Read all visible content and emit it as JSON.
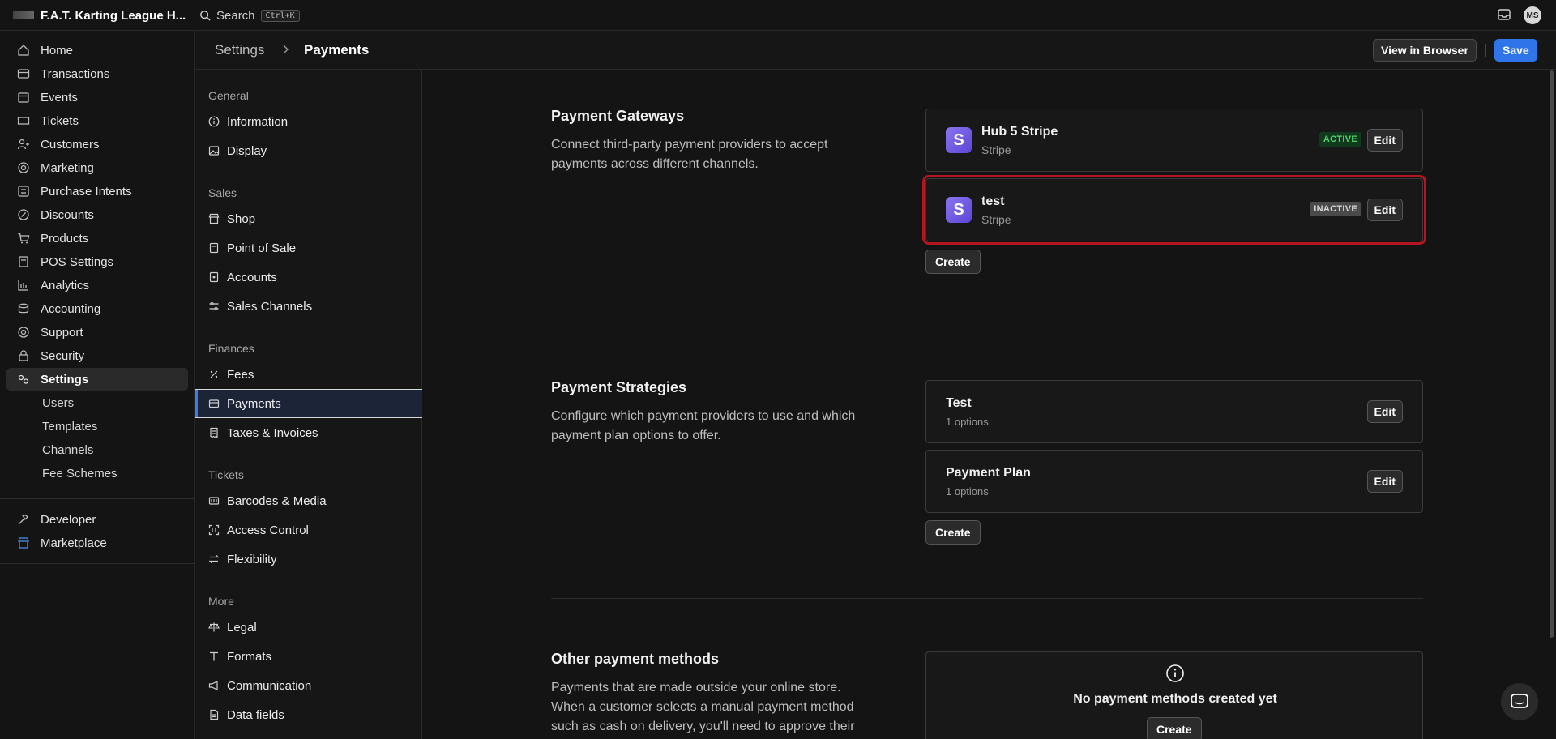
{
  "topbar": {
    "org_name": "F.A.T. Karting League H...",
    "search_label": "Search",
    "search_shortcut": "Ctrl+K",
    "avatar_initials": "MS"
  },
  "nav": {
    "items": [
      {
        "label": "Home",
        "icon": "home-icon"
      },
      {
        "label": "Transactions",
        "icon": "card-icon"
      },
      {
        "label": "Events",
        "icon": "calendar-icon"
      },
      {
        "label": "Tickets",
        "icon": "ticket-icon"
      },
      {
        "label": "Customers",
        "icon": "users-icon"
      },
      {
        "label": "Marketing",
        "icon": "target-icon"
      },
      {
        "label": "Purchase Intents",
        "icon": "list-icon"
      },
      {
        "label": "Discounts",
        "icon": "percent-icon"
      },
      {
        "label": "Products",
        "icon": "cart-icon"
      },
      {
        "label": "POS Settings",
        "icon": "pos-icon"
      },
      {
        "label": "Analytics",
        "icon": "chart-icon"
      },
      {
        "label": "Accounting",
        "icon": "coins-icon"
      },
      {
        "label": "Support",
        "icon": "lifebuoy-icon"
      },
      {
        "label": "Security",
        "icon": "lock-icon"
      },
      {
        "label": "Settings",
        "icon": "gear-icon"
      }
    ],
    "sub_items": [
      "Users",
      "Templates",
      "Channels",
      "Fee Schemes"
    ],
    "bottom_items": [
      {
        "label": "Developer",
        "icon": "hammer-icon"
      },
      {
        "label": "Marketplace",
        "icon": "store-icon"
      }
    ]
  },
  "header": {
    "breadcrumb_parent": "Settings",
    "breadcrumb_current": "Payments",
    "view_in_browser": "View in Browser",
    "save": "Save"
  },
  "settings_nav": {
    "groups": [
      {
        "title": "General",
        "items": [
          "Information",
          "Display"
        ]
      },
      {
        "title": "Sales",
        "items": [
          "Shop",
          "Point of Sale",
          "Accounts",
          "Sales Channels"
        ]
      },
      {
        "title": "Finances",
        "items": [
          "Fees",
          "Payments",
          "Taxes & Invoices"
        ]
      },
      {
        "title": "Tickets",
        "items": [
          "Barcodes & Media",
          "Access Control",
          "Flexibility"
        ]
      },
      {
        "title": "More",
        "items": [
          "Legal",
          "Formats",
          "Communication",
          "Data fields"
        ]
      }
    ],
    "active_item": "Payments"
  },
  "gateways": {
    "title": "Payment Gateways",
    "description": "Connect third-party payment providers to accept payments across different channels.",
    "cards": [
      {
        "name": "Hub 5 Stripe",
        "provider": "Stripe",
        "logo_letter": "S",
        "status": "ACTIVE",
        "edit": "Edit"
      },
      {
        "name": "test",
        "provider": "Stripe",
        "logo_letter": "S",
        "status": "INACTIVE",
        "edit": "Edit"
      }
    ],
    "create": "Create"
  },
  "strategies": {
    "title": "Payment Strategies",
    "description": "Configure which payment providers to use and which payment plan options to offer.",
    "cards": [
      {
        "name": "Test",
        "options": "1 options",
        "edit": "Edit"
      },
      {
        "name": "Payment Plan",
        "options": "1 options",
        "edit": "Edit"
      }
    ],
    "create": "Create"
  },
  "other_methods": {
    "title": "Other payment methods",
    "description": "Payments that are made outside your online store. When a customer selects a manual payment method such as cash on delivery, you'll need to approve their",
    "empty_text": "No payment methods created yet",
    "create": "Create"
  },
  "colors": {
    "accent": "#2f74e8",
    "active_badge": "#4fd36f",
    "highlight": "#b3161e",
    "stripe_logo": "#6b55e0"
  }
}
